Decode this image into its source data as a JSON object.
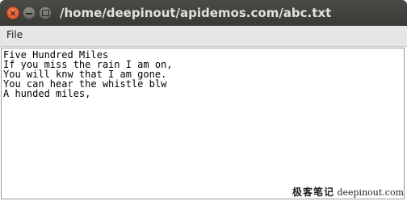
{
  "window": {
    "title": "/home/deepinout/apidemos.com/abc.txt"
  },
  "menubar": {
    "items": [
      {
        "label": "File"
      }
    ]
  },
  "editor": {
    "lines": [
      "Five Hundred Miles",
      "If you miss the rain I am on,",
      "You will knw that I am gone.",
      "You can hear the whistle blw",
      "A hunded miles,"
    ]
  },
  "watermark": {
    "chinese": "极客笔记",
    "site": "deepinout.com"
  }
}
